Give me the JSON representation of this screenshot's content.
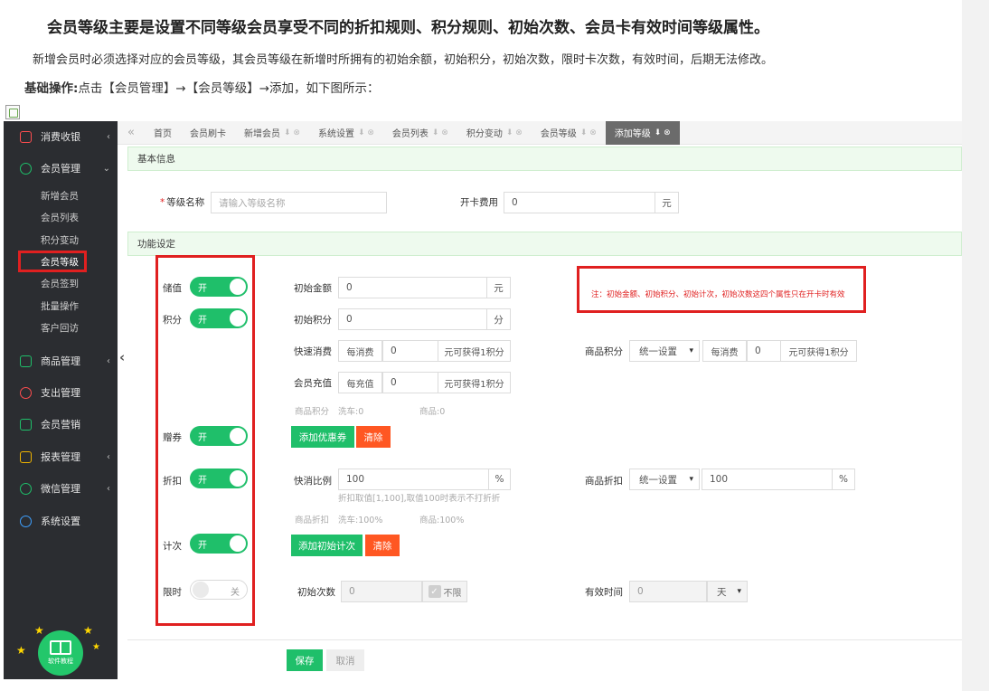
{
  "doc": {
    "title": "会员等级主要是设置不同等级会员享受不同的折扣规则、积分规则、初始次数、会员卡有效时间等级属性。",
    "paragraph": "新增会员时必须选择对应的会员等级，其会员等级在新增时所拥有的初始余额，初始积分，初始次数，限时卡次数，有效时间，后期无法修改。",
    "ops_label": "基础操作:",
    "ops_text": "点击【会员管理】→【会员等级】→添加，如下图所示："
  },
  "sidebar": {
    "top_item": "消费收银",
    "member_mgmt": "会员管理",
    "sub_items": [
      "新增会员",
      "会员列表",
      "积分变动",
      "会员等级",
      "会员签到",
      "批量操作",
      "客户回访"
    ],
    "goods_mgmt": "商品管理",
    "expense_mgmt": "支出管理",
    "marketing": "会员营销",
    "reports": "报表管理",
    "wechat": "微信管理",
    "settings": "系统设置",
    "badge_text": "软件教程"
  },
  "tabs": {
    "home": "首页",
    "list": [
      "会员刷卡",
      "新增会员",
      "系统设置",
      "会员列表",
      "积分变动",
      "会员等级",
      "添加等级"
    ]
  },
  "sections": {
    "basic": "基本信息",
    "function": "功能设定"
  },
  "basic": {
    "level_name_label": "等级名称",
    "level_name_placeholder": "请输入等级名称",
    "card_fee_label": "开卡费用",
    "card_fee_value": "0",
    "card_fee_unit": "元"
  },
  "toggles": {
    "stored_value": {
      "label": "储值",
      "state": "开"
    },
    "points": {
      "label": "积分",
      "state": "开"
    },
    "coupon": {
      "label": "赠券",
      "state": "开"
    },
    "discount": {
      "label": "折扣",
      "state": "开"
    },
    "count": {
      "label": "计次",
      "state": "开"
    },
    "timed": {
      "label": "限时",
      "state": "关"
    }
  },
  "fields": {
    "init_balance_label": "初始金额",
    "init_balance_value": "0",
    "init_balance_unit": "元",
    "init_points_label": "初始积分",
    "init_points_value": "0",
    "init_points_unit": "分",
    "quick_spend_label": "快速消费",
    "per_spend": "每消费",
    "quick_spend_value": "0",
    "earn_one_point": "元可获得1积分",
    "goods_points_label": "商品积分",
    "goods_points_select": "统一设置",
    "goods_spend_value": "0",
    "recharge_label": "会员充值",
    "per_recharge": "每充值",
    "recharge_value": "0",
    "points_hint_a": "商品积分",
    "points_hint_b": "洗车:0",
    "points_hint_c": "商品:0",
    "add_coupon": "添加优惠券",
    "clear": "清除",
    "quick_ratio_label": "快消比例",
    "quick_ratio_value": "100",
    "percent": "%",
    "ratio_hint": "折扣取值[1,100],取值100时表示不打折折",
    "goods_discount_label": "商品折扣",
    "goods_discount_select": "统一设置",
    "goods_discount_value": "100",
    "discount_hint_a": "商品折扣",
    "discount_hint_b": "洗车:100%",
    "discount_hint_c": "商品:100%",
    "add_init_count": "添加初始计次",
    "init_times_label": "初始次数",
    "init_times_value": "0",
    "unlimited": "不限",
    "valid_time_label": "有效时间",
    "valid_time_value": "0",
    "valid_unit": "天"
  },
  "note": "注：初始金额、初始积分、初始计次，初始次数这四个属性只在开卡时有效",
  "actions": {
    "save": "保存",
    "cancel": "取消"
  }
}
